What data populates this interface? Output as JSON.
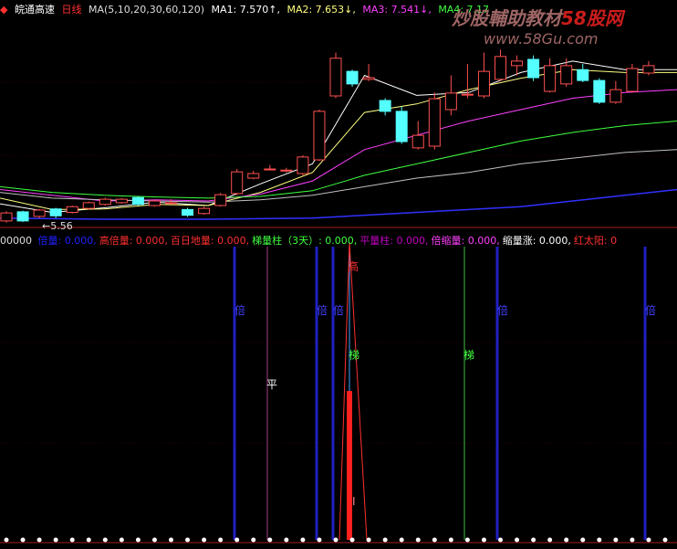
{
  "header": {
    "stock_name": "皖通高速",
    "period": "日线",
    "ma_params": "MA(5,10,20,30,60,120)",
    "ma1": "MA1: 7.570↑,",
    "ma2": "MA2: 7.653↓,",
    "ma3": "MA3: 7.541↓,",
    "ma4": "MA4: 7.17"
  },
  "indicator_header": {
    "left_value": "00000",
    "items": [
      {
        "label": "倍量: 0.000,",
        "color": "#2020ff"
      },
      {
        "label": "高倍量: 0.000,",
        "color": "#ff3030"
      },
      {
        "label": "百日地量: 0.000,",
        "color": "#ff3030"
      },
      {
        "label": "梯量柱（3天）: 0.000,",
        "color": "#40ff40"
      },
      {
        "label": "平量柱: 0.000,",
        "color": "#c000c0"
      },
      {
        "label": "倍缩量: 0.000,",
        "color": "#ff40ff"
      },
      {
        "label": "缩量涨: 0.000,",
        "color": "#ffffff"
      },
      {
        "label": "红太阳: 0",
        "color": "#ff3030"
      }
    ]
  },
  "watermark": {
    "line1": "炒股輔助教材",
    "line1b": "58股网",
    "line2": "www.58Gu.com"
  },
  "markers": {
    "bei": "倍",
    "ping": "平",
    "ti": "梯",
    "gao": "高",
    "i": "I"
  },
  "chart_data": {
    "type": "candlestick",
    "min_label": "5.56",
    "ylim": [
      5.4,
      9.0
    ],
    "candles": [
      [
        5.45,
        5.59,
        5.42,
        5.62
      ],
      [
        5.61,
        5.45,
        5.43,
        5.63
      ],
      [
        5.53,
        5.64,
        5.5,
        5.66
      ],
      [
        5.66,
        5.54,
        5.5,
        5.68
      ],
      [
        5.6,
        5.7,
        5.58,
        5.72
      ],
      [
        5.67,
        5.77,
        5.65,
        5.79
      ],
      [
        5.74,
        5.83,
        5.72,
        5.86
      ],
      [
        5.77,
        5.83,
        5.75,
        5.85
      ],
      [
        5.86,
        5.74,
        5.72,
        5.88
      ],
      [
        5.72,
        5.8,
        5.7,
        5.82
      ],
      [
        5.77,
        5.77,
        5.74,
        5.83
      ],
      [
        5.65,
        5.55,
        5.52,
        5.68
      ],
      [
        5.58,
        5.67,
        5.56,
        5.7
      ],
      [
        5.72,
        5.91,
        5.7,
        5.94
      ],
      [
        5.93,
        6.31,
        5.9,
        6.36
      ],
      [
        6.2,
        6.28,
        6.18,
        6.33
      ],
      [
        6.36,
        6.36,
        6.34,
        6.43
      ],
      [
        6.34,
        6.34,
        6.3,
        6.38
      ],
      [
        6.28,
        6.57,
        6.25,
        6.6
      ],
      [
        6.52,
        7.37,
        6.5,
        7.4
      ],
      [
        7.64,
        8.3,
        7.6,
        8.4
      ],
      [
        8.07,
        7.85,
        7.8,
        8.1
      ],
      [
        7.93,
        7.96,
        7.9,
        8.2
      ],
      [
        7.56,
        7.37,
        7.3,
        7.6
      ],
      [
        7.37,
        6.84,
        6.8,
        7.45
      ],
      [
        6.73,
        6.95,
        6.7,
        7.2
      ],
      [
        6.76,
        7.59,
        6.7,
        7.7
      ],
      [
        7.4,
        7.69,
        7.3,
        8.0
      ],
      [
        7.67,
        7.67,
        7.6,
        8.2
      ],
      [
        7.64,
        8.07,
        7.6,
        8.4
      ],
      [
        7.93,
        8.33,
        7.9,
        8.45
      ],
      [
        8.17,
        8.25,
        8.0,
        8.35
      ],
      [
        8.28,
        7.96,
        7.9,
        8.35
      ],
      [
        7.72,
        8.17,
        7.7,
        8.3
      ],
      [
        7.85,
        8.17,
        7.8,
        8.3
      ],
      [
        8.1,
        7.91,
        7.88,
        8.2
      ],
      [
        7.91,
        7.53,
        7.5,
        7.95
      ],
      [
        7.53,
        7.75,
        7.5,
        7.9
      ],
      [
        7.72,
        8.12,
        7.7,
        8.2
      ],
      [
        8.04,
        8.17,
        8.0,
        8.25
      ]
    ],
    "ma_series": [
      {
        "name": "MA1",
        "color": "#ffffff",
        "values": [
          5.75,
          5.6,
          5.68,
          5.78,
          5.72,
          6.1,
          6.45,
          8.0,
          7.65,
          7.7,
          8.05,
          8.25,
          8.1,
          8.1
        ]
      },
      {
        "name": "MA2",
        "color": "#ffff80",
        "values": [
          5.85,
          5.65,
          5.66,
          5.74,
          5.72,
          5.95,
          6.3,
          7.35,
          7.5,
          7.75,
          7.95,
          8.1,
          8.05,
          8.05
        ]
      },
      {
        "name": "MA3",
        "color": "#ff40ff",
        "values": [
          6.0,
          5.9,
          5.8,
          5.82,
          5.8,
          5.92,
          6.15,
          6.7,
          6.95,
          7.2,
          7.4,
          7.6,
          7.7,
          7.75
        ]
      },
      {
        "name": "MA4",
        "color": "#40ff40",
        "values": [
          6.05,
          5.95,
          5.9,
          5.87,
          5.85,
          5.88,
          5.98,
          6.25,
          6.45,
          6.65,
          6.85,
          7.0,
          7.12,
          7.2
        ]
      },
      {
        "name": "MA5",
        "color": "#c0c0c0",
        "values": [
          5.95,
          5.85,
          5.82,
          5.8,
          5.78,
          5.82,
          5.9,
          6.05,
          6.2,
          6.3,
          6.45,
          6.55,
          6.65,
          6.7
        ]
      },
      {
        "name": "MA6",
        "color": "#3030ff",
        "values": [
          5.5,
          5.49,
          5.48,
          5.48,
          5.48,
          5.49,
          5.5,
          5.55,
          5.6,
          5.65,
          5.7,
          5.8,
          5.9,
          6.0
        ]
      }
    ]
  }
}
